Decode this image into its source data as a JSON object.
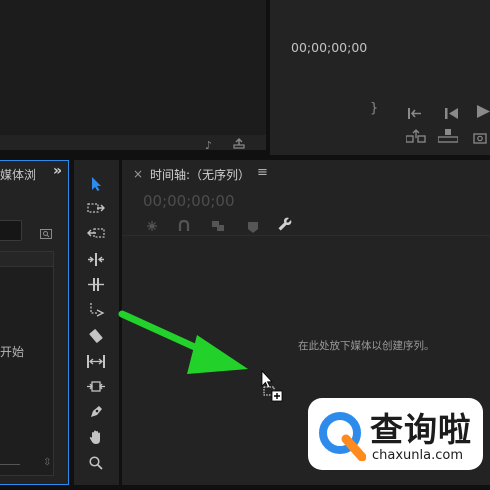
{
  "program_monitor": {
    "timecode": "00;00;00;00"
  },
  "project_panel": {
    "tab_label": "媒体浏",
    "expand_glyph": "»",
    "placeholder_partial": "开始"
  },
  "timeline": {
    "close_glyph": "×",
    "title": "时间轴:（无序列）",
    "menu_glyph": "≡",
    "timecode": "00;00;00;00",
    "drop_hint": "在此处放下媒体以创建序列。"
  },
  "watermark": {
    "brand_cn": "查询啦",
    "brand_url": "chaxunla.com"
  },
  "colors": {
    "accent_blue": "#2d8ceb",
    "arrow_green": "#22d22a",
    "panel_bg": "#232323",
    "gap_bg": "#101010"
  }
}
